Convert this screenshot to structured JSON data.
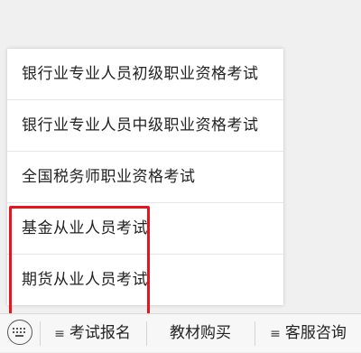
{
  "popup_menu": {
    "items": [
      {
        "label": "银行业专业人员初级职业资格考试"
      },
      {
        "label": "银行业专业人员中级职业资格考试"
      },
      {
        "label": "全国税务师职业资格考试"
      },
      {
        "label": "基金从业人员考试"
      },
      {
        "label": "期货从业人员考试"
      }
    ]
  },
  "bottom_bar": {
    "keyboard_icon": "keyboard-icon",
    "menus": [
      {
        "label": "考试报名",
        "icon": "menu-lines-icon",
        "symbol": "≡"
      },
      {
        "label": "教材购买"
      },
      {
        "label": "客服咨询",
        "icon": "menu-lines-icon",
        "symbol": "≡"
      }
    ]
  },
  "colors": {
    "highlight": "#e8141b",
    "text": "#222222",
    "background": "#f0f0f0"
  }
}
